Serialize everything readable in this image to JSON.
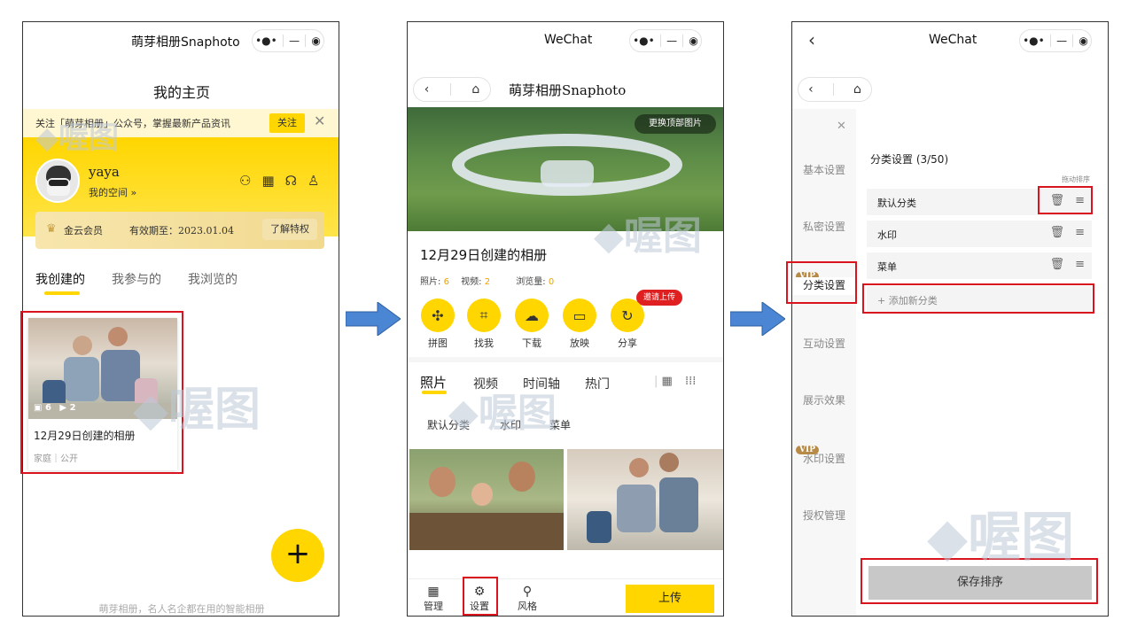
{
  "panel1": {
    "title": "萌芽相册Snaphoto",
    "page_heading": "我的主页",
    "notice": "关注「萌芽相册」公众号，掌握最新产品资讯",
    "follow_button": "关注",
    "user_name": "yaya",
    "my_space": "我的空间 »",
    "membership": "金云会员",
    "expiry": "有效期至：2023.01.04",
    "benefits_button": "了解特权",
    "tabs": [
      "我创建的",
      "我参与的",
      "我浏览的"
    ],
    "album": {
      "photo_count": "6",
      "video_count": "2",
      "title": "12月29日创建的相册",
      "meta": "家庭｜公开"
    },
    "footer": "萌芽相册，名人名企都在用的智能相册",
    "fab": "+"
  },
  "panel2": {
    "title": "WeChat",
    "page_title": "萌芽相册Snaphoto",
    "change_cover": "更换顶部图片",
    "album_title": "12月29日创建的相册",
    "stats": {
      "photos_label": "照片:",
      "photos_value": "6",
      "videos_label": "视频:",
      "videos_value": "2",
      "views_label": "浏览量:",
      "views_value": "0"
    },
    "invite_badge": "邀请上传",
    "tools": [
      "拼图",
      "找我",
      "下载",
      "放映",
      "分享"
    ],
    "tabs": [
      "照片",
      "视频",
      "时间轴",
      "热门"
    ],
    "categories": [
      "默认分类",
      "水印",
      "菜单"
    ],
    "bottom_nav": [
      "管理",
      "设置",
      "风格"
    ],
    "upload_button": "上传"
  },
  "panel3": {
    "title": "WeChat",
    "sidebar": [
      "基本设置",
      "私密设置",
      "分类设置",
      "互动设置",
      "展示效果",
      "水印设置",
      "授权管理"
    ],
    "vip": "VIP",
    "heading": "分类设置 (3/50)",
    "drag_hint": "拖动排序",
    "categories": [
      "默认分类",
      "水印",
      "菜单"
    ],
    "add_category": "+ 添加新分类",
    "save_button": "保存排序"
  },
  "watermark": "喔图",
  "colors": {
    "accent": "#ffd600",
    "highlight_red": "#d9141f",
    "arrow_blue": "#4a86d4"
  }
}
